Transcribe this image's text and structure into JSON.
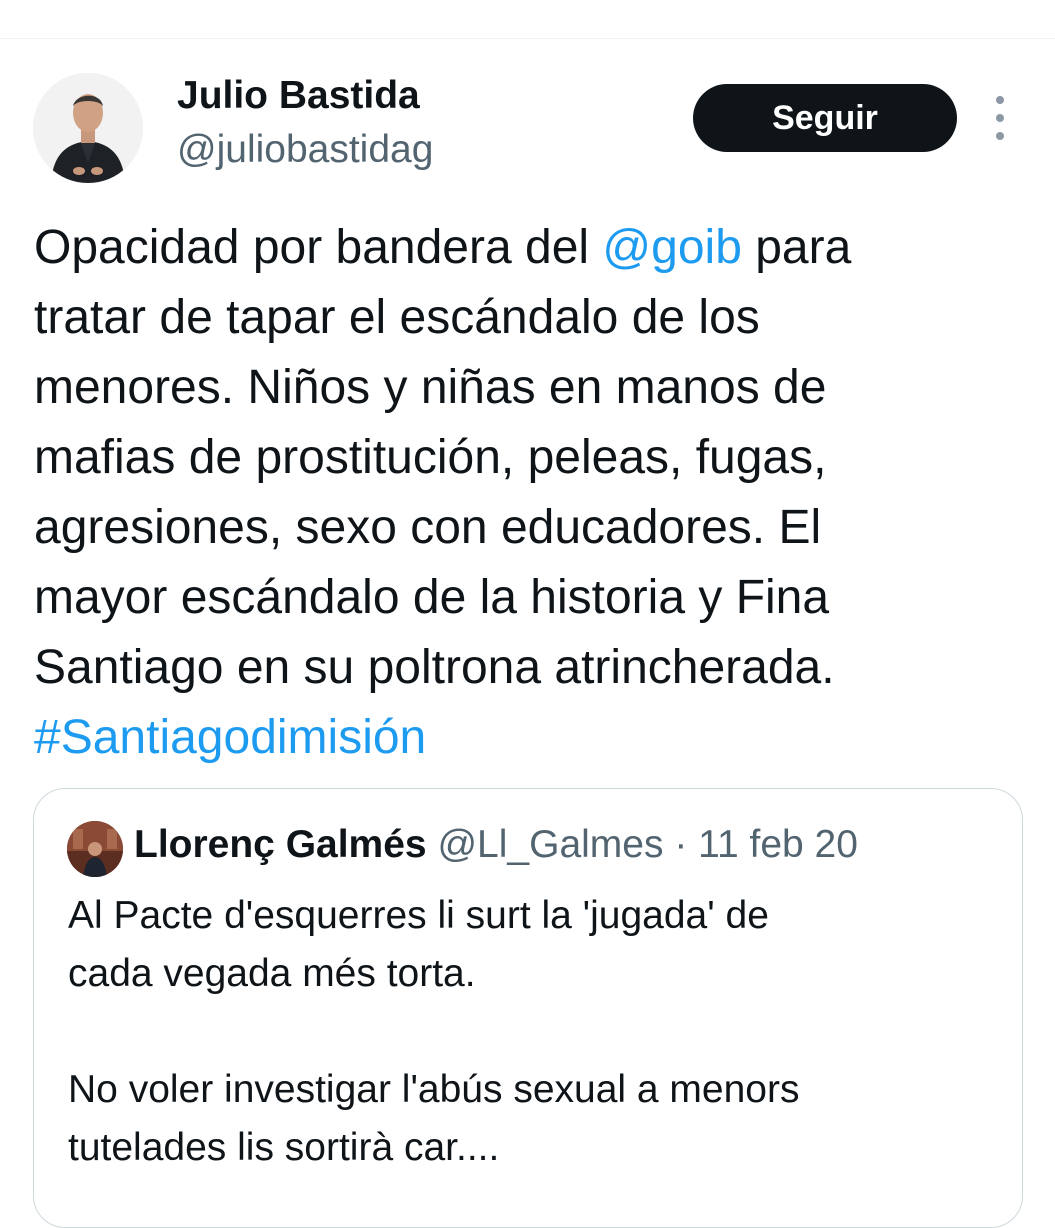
{
  "author": {
    "name": "Julio Bastida",
    "handle": "@juliobastidag"
  },
  "follow_button_label": "Seguir",
  "tweet": {
    "segments": [
      {
        "text": "Opacidad por bandera del ",
        "type": "text"
      },
      {
        "text": "@goib",
        "type": "mention"
      },
      {
        "text": " para\ntratar de tapar el escándalo de los\nmenores. Niños y niñas en manos de\nmafias de prostitución, peleas, fugas,\nagresiones, sexo con educadores. El\nmayor escándalo de la historia y Fina\nSantiago en su poltrona atrincherada.\n",
        "type": "text"
      },
      {
        "text": "#Santiagodimisión",
        "type": "hashtag"
      }
    ]
  },
  "quoted_tweet": {
    "name": "Llorenç Galmés",
    "handle": "@Ll_Galmes",
    "separator": " · ",
    "date": "11 feb 20",
    "text": "Al Pacte d'esquerres li surt la 'jugada' de\ncada vegada més torta.\n\nNo voler investigar l'abús sexual a menors\ntutelades lis sortirà car...."
  },
  "colors": {
    "link": "#1d9bf0",
    "text": "#0f1419",
    "secondary_text": "#536471",
    "button_bg": "#0f1419",
    "border": "#cfd9de"
  },
  "icons": {
    "more": "more-options-icon"
  }
}
